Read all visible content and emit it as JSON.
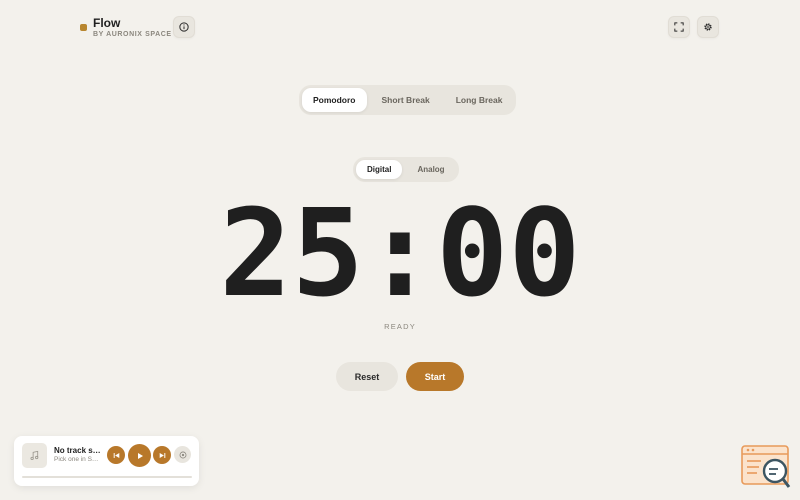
{
  "app": {
    "title": "Flow",
    "subtitle": "BY AURONIX SPACE"
  },
  "header": {
    "info_icon": "info-icon",
    "fullscreen_icon": "expand-icon",
    "settings_icon": "gear-icon"
  },
  "mode_tabs": [
    {
      "label": "Pomodoro",
      "active": true
    },
    {
      "label": "Short Break",
      "active": false
    },
    {
      "label": "Long Break",
      "active": false
    }
  ],
  "view_tabs": [
    {
      "label": "Digital",
      "active": true
    },
    {
      "label": "Analog",
      "active": false
    }
  ],
  "timer": {
    "display": "25:00",
    "status": "READY"
  },
  "controls": {
    "reset_label": "Reset",
    "start_label": "Start"
  },
  "player": {
    "track": "No track s…",
    "hint": "Pick one in S…",
    "icons": [
      "music-note-icon",
      "skip-back-icon",
      "play-icon",
      "skip-forward-icon",
      "source-icon"
    ]
  },
  "colors": {
    "accent": "#b8782a",
    "background": "#f3f1ec"
  }
}
